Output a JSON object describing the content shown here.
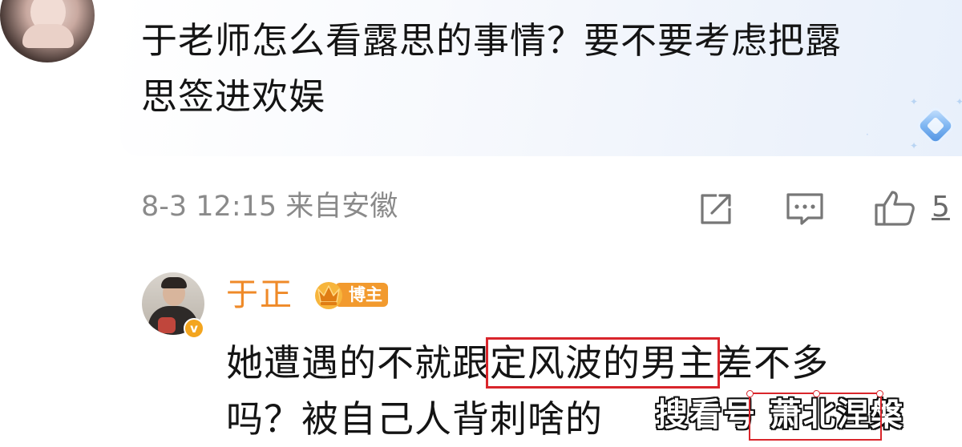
{
  "comment": {
    "text_line1": "于老师怎么看露思的事情？要不要考虑把露",
    "text_line2": "思签进欢娱",
    "meta": "8-3 12:15 来自安徽",
    "like_count": "5",
    "actions": [
      "share-icon",
      "comment-icon",
      "like-icon"
    ]
  },
  "reply": {
    "author": "于正",
    "badge": "博主",
    "line1_before": "她遭遇的不就跟",
    "line1_boxed": "定风波的男主",
    "line1_after": "差不多",
    "line2": "吗？被自己人背刺啥的"
  },
  "watermark": {
    "text": "搜看号 萧北涅槃"
  },
  "colors": {
    "name_orange": "#ef8a28",
    "badge_orange": "#f29a2e",
    "highlight_red": "#d9252b",
    "meta_gray": "#8a8a8a"
  }
}
